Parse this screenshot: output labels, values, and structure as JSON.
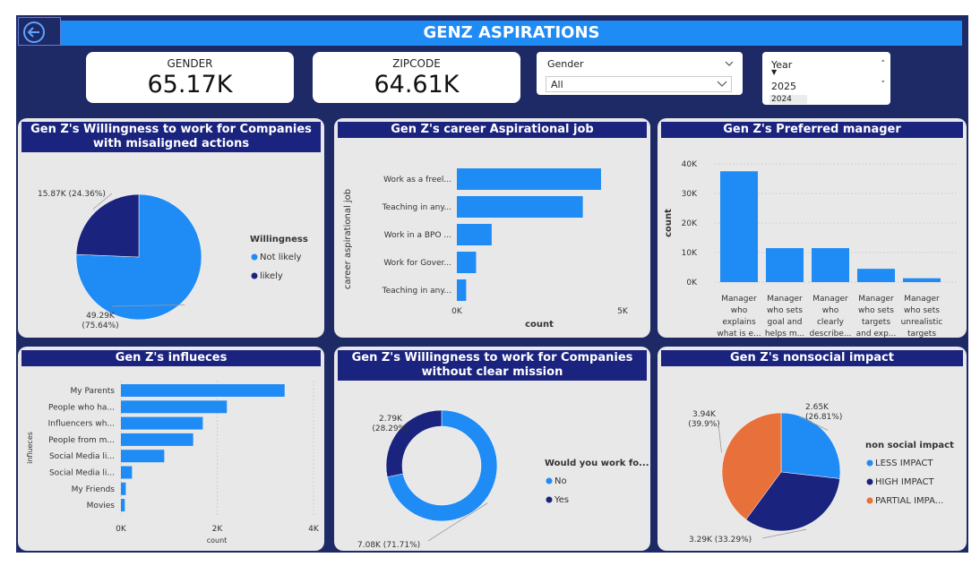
{
  "header": {
    "title": "GENZ ASPIRATIONS"
  },
  "cards": [
    {
      "label": "GENDER",
      "value": "65.17K"
    },
    {
      "label": "ZIPCODE",
      "value": "64.61K"
    }
  ],
  "slicers": {
    "gender": {
      "title": "Gender",
      "selected": "All"
    },
    "year": {
      "title": "Year",
      "items": [
        "2025",
        "2024"
      ]
    }
  },
  "colors": {
    "primary": "#1f8bf5",
    "dark": "#1a237e",
    "orange": "#e8703a",
    "panel": "#e8e8e8",
    "dashboard": "#1e2a66"
  },
  "chart_data": [
    {
      "id": "willingness_misaligned",
      "type": "pie",
      "title": "Gen Z's Willingness to work for Companies with misaligned actions",
      "legend_title": "Willingness",
      "legend_position": "right",
      "series": [
        {
          "name": "Not likely",
          "value": 49.29,
          "label": "49.29K\n(75.64%)",
          "color": "#1f8bf5"
        },
        {
          "name": "likely",
          "value": 15.87,
          "label": "15.87K (24.36%)",
          "color": "#1a237e"
        }
      ]
    },
    {
      "id": "career_aspirational",
      "type": "bar",
      "orientation": "horizontal",
      "title": "Gen Z's career Aspirational job",
      "xlabel": "count",
      "ylabel": "career aspirational job",
      "xlim": [
        0,
        5000
      ],
      "x_ticks": [
        "0K",
        "5K"
      ],
      "categories": [
        "Work as a freel...",
        "Teaching in any...",
        "Work in a BPO ...",
        "Work for Gover...",
        "Teaching in any..."
      ],
      "values": [
        4350,
        3800,
        1050,
        580,
        280
      ]
    },
    {
      "id": "preferred_manager",
      "type": "bar",
      "title": "Gen Z's Preferred manager",
      "ylabel": "count",
      "ylim": [
        0,
        40000
      ],
      "y_ticks": [
        "40K",
        "30K",
        "20K",
        "10K",
        "0K"
      ],
      "grid": true,
      "categories": [
        [
          "Manager",
          "who",
          "explains",
          "what is e..."
        ],
        [
          "Manager",
          "who sets",
          "goal and",
          "helps m..."
        ],
        [
          "Manager",
          "who",
          "clearly",
          "describe..."
        ],
        [
          "Manager",
          "who sets",
          "targets",
          "and exp..."
        ],
        [
          "Manager",
          "who sets",
          "unrealistic",
          "targets"
        ]
      ],
      "values": [
        37500,
        11500,
        11500,
        4500,
        1300
      ]
    },
    {
      "id": "influences",
      "type": "bar",
      "orientation": "horizontal",
      "title": "Gen Z's influeces",
      "xlabel": "count",
      "ylabel": "influeces",
      "xlim": [
        0,
        4000
      ],
      "x_ticks": [
        "0K",
        "2K",
        "4K"
      ],
      "grid": true,
      "categories": [
        "My Parents",
        "People who ha...",
        "Influencers wh...",
        "People from m...",
        "Social Media li...",
        "Social Media li...",
        "My Friends",
        "Movies"
      ],
      "values": [
        3400,
        2200,
        1700,
        1500,
        900,
        230,
        100,
        80
      ]
    },
    {
      "id": "willingness_mission",
      "type": "pie",
      "title": "Gen Z's Willingness to work for Companies without clear mission",
      "legend_title": "Would you work fo...",
      "legend_position": "right",
      "series": [
        {
          "name": "No",
          "value": 7.08,
          "label": "7.08K (71.71%)",
          "color": "#1f8bf5"
        },
        {
          "name": "Yes",
          "value": 2.79,
          "label": "2.79K\n(28.29%)",
          "color": "#1a237e"
        }
      ]
    },
    {
      "id": "nonsocial_impact",
      "type": "pie",
      "title": "Gen Z's nonsocial impact",
      "legend_title": "non social impact",
      "legend_position": "right",
      "series": [
        {
          "name": "LESS IMPACT",
          "value": 2.65,
          "label": "2.65K\n(26.81%)",
          "color": "#1f8bf5"
        },
        {
          "name": "HIGH IMPACT",
          "value": 3.29,
          "label": "3.29K (33.29%)",
          "color": "#1a237e"
        },
        {
          "name": "PARTIAL IMPA...",
          "value": 3.94,
          "label": "3.94K\n(39.9%)",
          "color": "#e8703a"
        }
      ]
    }
  ]
}
